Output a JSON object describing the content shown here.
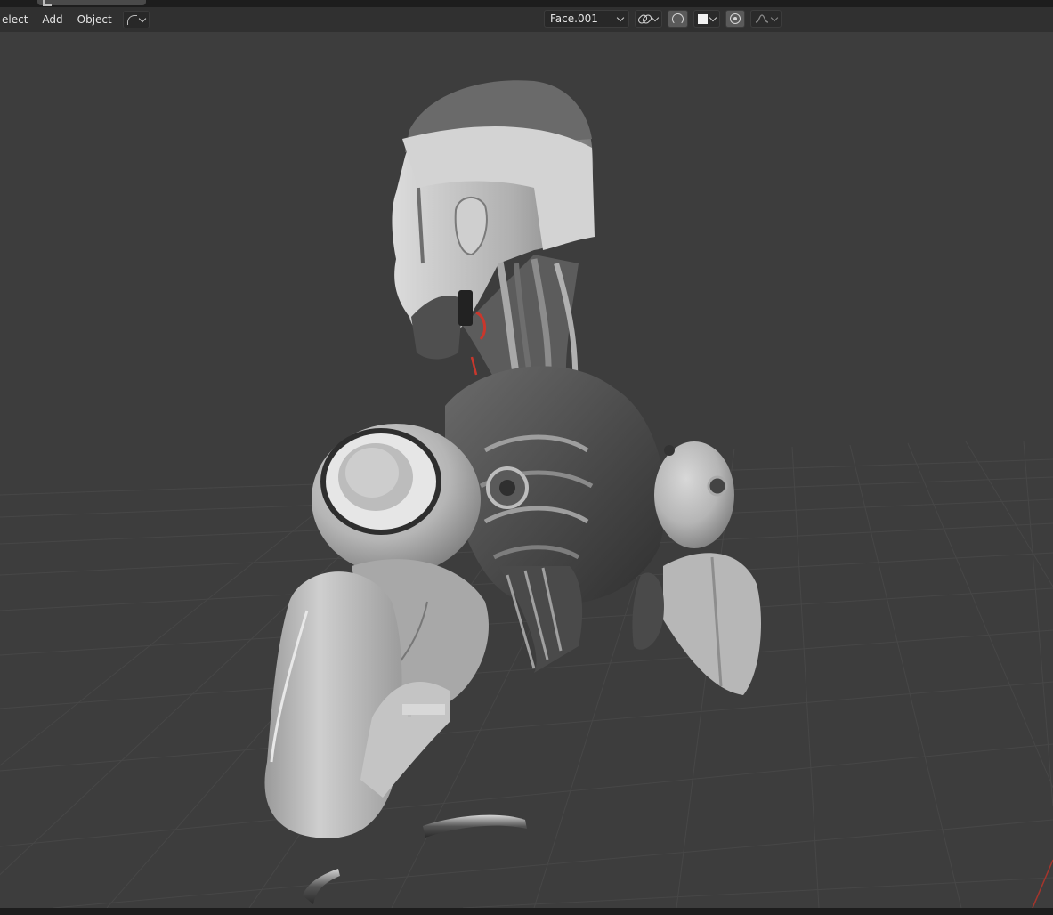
{
  "menu": {
    "items": [
      "elect",
      "Add",
      "Object"
    ]
  },
  "header": {
    "object_selector": "Face.001",
    "icons": {
      "mode": "curve-mode-icon",
      "link": "link-icon",
      "snap": "snap-icon",
      "swatch": "color-swatch-icon",
      "proportional": "proportional-editing-icon",
      "falloff": "falloff-curve-icon"
    }
  },
  "colors": {
    "viewport_bg": "#3d3d3d",
    "grid_line": "#4a4a4a",
    "header_bg": "#303030",
    "accent_red": "#c9372c"
  },
  "scene": {
    "subject": "robot-bust-model",
    "floor": "grid-floor"
  }
}
